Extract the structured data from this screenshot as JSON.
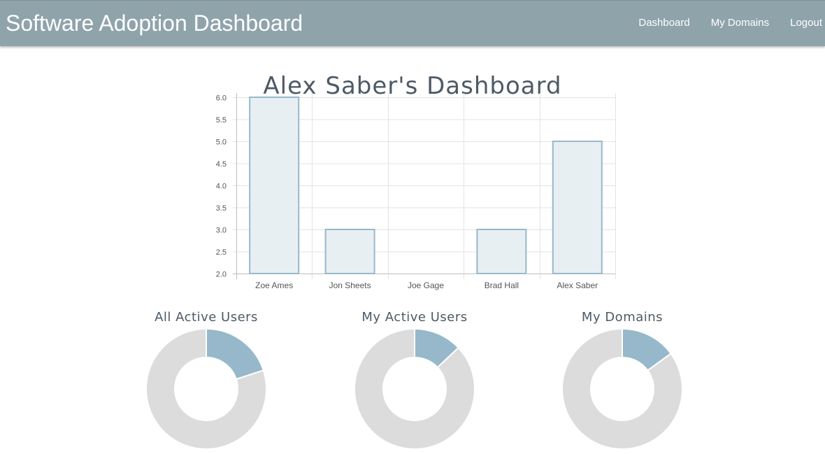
{
  "navbar": {
    "brand": "Software Adoption Dashboard",
    "links": [
      "Dashboard",
      "My Domains",
      "Logout"
    ]
  },
  "page": {
    "title": "Alex Saber's Dashboard"
  },
  "colors": {
    "navbar": "#8fa3ab",
    "accent": "#97b8cb",
    "donut_rest": "#dcdcdc",
    "bar_fill": "#e8eff2",
    "bar_stroke": "#97b8cb"
  },
  "chart_data": [
    {
      "type": "bar",
      "categories": [
        "Zoe Ames",
        "Jon Sheets",
        "Joe Gage",
        "Brad Hall",
        "Alex Saber"
      ],
      "values": [
        6.0,
        3.0,
        2.0,
        3.0,
        5.0
      ],
      "ylim": [
        2.0,
        6.0
      ],
      "yticks": [
        "6.0",
        "5.5",
        "5.0",
        "4.5",
        "4.0",
        "3.5",
        "3.0",
        "2.5",
        "2.0"
      ],
      "grid": true
    },
    {
      "type": "pie",
      "title": "All Active Users",
      "values": [
        20,
        80
      ]
    },
    {
      "type": "pie",
      "title": "My Active Users",
      "values": [
        13,
        87
      ]
    },
    {
      "type": "pie",
      "title": "My Domains",
      "values": [
        15,
        85
      ]
    }
  ]
}
